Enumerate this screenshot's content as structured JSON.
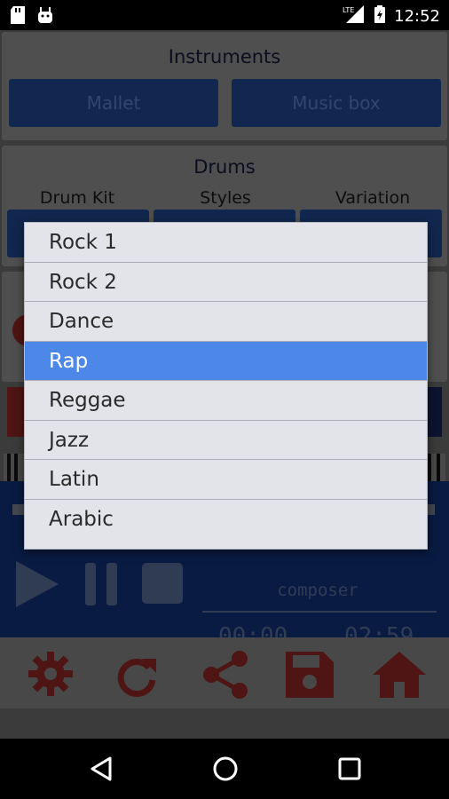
{
  "status": {
    "time": "12:52",
    "network": "LTE"
  },
  "instruments": {
    "title": "Instruments",
    "left_button": "Mallet",
    "right_button": "Music box"
  },
  "drums": {
    "title": "Drums",
    "col1": "Drum Kit",
    "col2": "Styles",
    "col3": "Variation"
  },
  "player": {
    "composer": "composer",
    "current_time": "00:00",
    "total_time": "02:59"
  },
  "dropdown": {
    "items": [
      "Rock 1",
      "Rock 2",
      "Dance",
      "Rap",
      "Reggae",
      "Jazz",
      "Latin",
      "Arabic"
    ],
    "selected": "Rap"
  },
  "colors": {
    "accent_red": "#7a2020",
    "selected_blue": "#4d87e8"
  }
}
